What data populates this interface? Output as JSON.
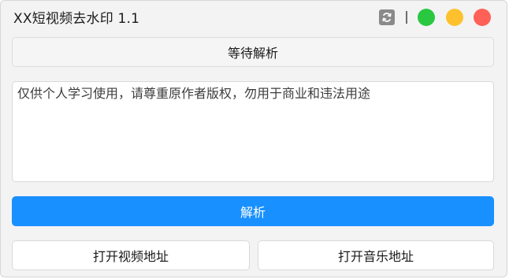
{
  "window": {
    "title": "XX短视频去水印 1.1",
    "controls": {
      "refresh_icon": "refresh-icon",
      "green": "#29c840",
      "yellow": "#fec12e",
      "red": "#ff6057"
    }
  },
  "status": {
    "text": "等待解析"
  },
  "input": {
    "value": "仅供个人学习使用，请尊重原作者版权，勿用于商业和违法用途"
  },
  "actions": {
    "parse_label": "解析",
    "open_video_label": "打开视频地址",
    "open_music_label": "打开音乐地址"
  },
  "colors": {
    "accent": "#1890ff"
  }
}
